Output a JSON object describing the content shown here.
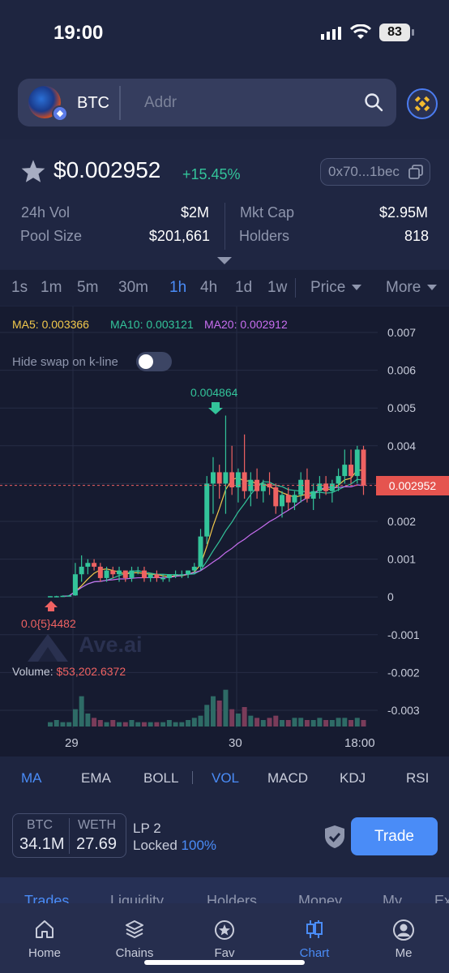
{
  "status": {
    "time": "19:00",
    "battery": "83"
  },
  "search": {
    "token_symbol": "BTC",
    "placeholder": "Addr"
  },
  "token": {
    "price": "$0.002952",
    "change": "+15.45%",
    "address_short": "0x70...1bec",
    "stats": {
      "vol_label": "24h Vol",
      "vol_value": "$2M",
      "mktcap_label": "Mkt Cap",
      "mktcap_value": "$2.95M",
      "pool_label": "Pool Size",
      "pool_value": "$201,661",
      "holders_label": "Holders",
      "holders_value": "818"
    }
  },
  "timeframes": [
    "1s",
    "1m",
    "5m",
    "30m",
    "1h",
    "4h",
    "1d",
    "1w"
  ],
  "active_timeframe": "1h",
  "dropdowns": {
    "price": "Price",
    "more": "More"
  },
  "chart_labels": {
    "ma5": "MA5: 0.003366",
    "ma10": "MA10: 0.003121",
    "ma20": "MA20: 0.002912",
    "hide_swap": "Hide swap on k-line",
    "high": "0.004864",
    "low": "0.0{5}4482",
    "watermark": "Ave.ai",
    "volume_label": "Volume: ",
    "volume_value": "$53,202.6372",
    "current_price": "0.002952"
  },
  "colors": {
    "up": "#33c49a",
    "down": "#ef6262",
    "accent": "#4a8cf7",
    "ma5": "#f2c94c",
    "ma10": "#33c49a",
    "ma20": "#c86ef0"
  },
  "chart_data": {
    "type": "candlestick",
    "y_ticks": [
      "0.007",
      "0.006",
      "0.005",
      "0.004",
      "0.003",
      "0.002",
      "0.001",
      "0",
      "-0.001",
      "-0.002",
      "-0.003"
    ],
    "ylim": [
      -0.0033,
      0.0074
    ],
    "x_ticks": [
      "29",
      "30",
      "18:00"
    ],
    "candles": [
      {
        "o": 1e-05,
        "h": 2e-05,
        "l": 0.0,
        "c": 2e-05
      },
      {
        "o": 2e-05,
        "h": 3e-05,
        "l": 1e-05,
        "c": 2e-05
      },
      {
        "o": 2e-05,
        "h": 4e-05,
        "l": 1e-05,
        "c": 3e-05
      },
      {
        "o": 3e-05,
        "h": 5e-05,
        "l": 2e-05,
        "c": 4e-05
      },
      {
        "o": 4e-05,
        "h": 0.0009,
        "l": 3e-05,
        "c": 0.0006
      },
      {
        "o": 0.0006,
        "h": 0.0011,
        "l": 0.0004,
        "c": 0.0008
      },
      {
        "o": 0.0008,
        "h": 0.001,
        "l": 0.0006,
        "c": 0.0009
      },
      {
        "o": 0.0009,
        "h": 0.001,
        "l": 0.0007,
        "c": 0.0008
      },
      {
        "o": 0.0008,
        "h": 0.0009,
        "l": 0.0004,
        "c": 0.0005
      },
      {
        "o": 0.0005,
        "h": 0.0008,
        "l": 0.0004,
        "c": 0.0007
      },
      {
        "o": 0.0007,
        "h": 0.0008,
        "l": 0.0005,
        "c": 0.0006
      },
      {
        "o": 0.0006,
        "h": 0.0008,
        "l": 0.0004,
        "c": 0.0007
      },
      {
        "o": 0.0007,
        "h": 0.0007,
        "l": 0.0004,
        "c": 0.0005
      },
      {
        "o": 0.0005,
        "h": 0.0008,
        "l": 0.0004,
        "c": 0.0007
      },
      {
        "o": 0.0007,
        "h": 0.0008,
        "l": 0.0006,
        "c": 0.0007
      },
      {
        "o": 0.0007,
        "h": 0.0008,
        "l": 0.0004,
        "c": 0.0005
      },
      {
        "o": 0.0005,
        "h": 0.0006,
        "l": 0.0004,
        "c": 0.0006
      },
      {
        "o": 0.0006,
        "h": 0.0007,
        "l": 0.0004,
        "c": 0.0005
      },
      {
        "o": 0.0005,
        "h": 0.0006,
        "l": 0.0004,
        "c": 0.0005
      },
      {
        "o": 0.0005,
        "h": 0.0006,
        "l": 0.0004,
        "c": 0.0006
      },
      {
        "o": 0.0006,
        "h": 0.0007,
        "l": 0.0005,
        "c": 0.0006
      },
      {
        "o": 0.0006,
        "h": 0.0007,
        "l": 0.0005,
        "c": 0.0006
      },
      {
        "o": 0.0006,
        "h": 0.0007,
        "l": 0.0005,
        "c": 0.0007
      },
      {
        "o": 0.0007,
        "h": 0.0009,
        "l": 0.0006,
        "c": 0.0008
      },
      {
        "o": 0.0008,
        "h": 0.0018,
        "l": 0.0007,
        "c": 0.0016
      },
      {
        "o": 0.0016,
        "h": 0.0032,
        "l": 0.0014,
        "c": 0.003
      },
      {
        "o": 0.003,
        "h": 0.0037,
        "l": 0.0022,
        "c": 0.0033
      },
      {
        "o": 0.0033,
        "h": 0.0035,
        "l": 0.0026,
        "c": 0.003
      },
      {
        "o": 0.003,
        "h": 0.0048,
        "l": 0.0022,
        "c": 0.0033
      },
      {
        "o": 0.0033,
        "h": 0.004,
        "l": 0.0027,
        "c": 0.0029
      },
      {
        "o": 0.0029,
        "h": 0.0034,
        "l": 0.0025,
        "c": 0.0033
      },
      {
        "o": 0.0033,
        "h": 0.0043,
        "l": 0.0026,
        "c": 0.0028
      },
      {
        "o": 0.0028,
        "h": 0.0033,
        "l": 0.0024,
        "c": 0.0031
      },
      {
        "o": 0.0031,
        "h": 0.0034,
        "l": 0.0026,
        "c": 0.0028
      },
      {
        "o": 0.0028,
        "h": 0.0031,
        "l": 0.0025,
        "c": 0.003
      },
      {
        "o": 0.003,
        "h": 0.0033,
        "l": 0.0027,
        "c": 0.0029
      },
      {
        "o": 0.0029,
        "h": 0.003,
        "l": 0.0022,
        "c": 0.0024
      },
      {
        "o": 0.0024,
        "h": 0.0028,
        "l": 0.0021,
        "c": 0.0027
      },
      {
        "o": 0.0027,
        "h": 0.0029,
        "l": 0.0023,
        "c": 0.0025
      },
      {
        "o": 0.0025,
        "h": 0.0028,
        "l": 0.0023,
        "c": 0.0027
      },
      {
        "o": 0.0027,
        "h": 0.0033,
        "l": 0.0025,
        "c": 0.0031
      },
      {
        "o": 0.0031,
        "h": 0.0034,
        "l": 0.0025,
        "c": 0.0026
      },
      {
        "o": 0.0026,
        "h": 0.003,
        "l": 0.0023,
        "c": 0.0028
      },
      {
        "o": 0.0028,
        "h": 0.0032,
        "l": 0.0026,
        "c": 0.003
      },
      {
        "o": 0.003,
        "h": 0.0032,
        "l": 0.0027,
        "c": 0.0028
      },
      {
        "o": 0.0028,
        "h": 0.0031,
        "l": 0.0025,
        "c": 0.003
      },
      {
        "o": 0.003,
        "h": 0.0034,
        "l": 0.0028,
        "c": 0.0032
      },
      {
        "o": 0.0032,
        "h": 0.0039,
        "l": 0.003,
        "c": 0.0035
      },
      {
        "o": 0.0035,
        "h": 0.0039,
        "l": 0.003,
        "c": 0.0032
      },
      {
        "o": 0.0032,
        "h": 0.004,
        "l": 0.003,
        "c": 0.0039
      },
      {
        "o": 0.0039,
        "h": 0.004,
        "l": 0.0027,
        "c": 0.00295
      }
    ],
    "volumes": [
      2,
      3,
      2,
      2,
      8,
      14,
      6,
      4,
      3,
      2,
      3,
      2,
      2,
      3,
      2,
      2,
      2,
      2,
      2,
      3,
      2,
      2,
      3,
      4,
      5,
      10,
      14,
      12,
      17,
      8,
      6,
      9,
      5,
      4,
      3,
      4,
      5,
      3,
      3,
      4,
      4,
      3,
      3,
      4,
      3,
      3,
      4,
      4,
      3,
      4,
      3
    ],
    "volume_max": 60
  },
  "indicators": [
    "MA",
    "EMA",
    "BOLL",
    "VOL",
    "MACD",
    "KDJ",
    "RSI"
  ],
  "active_indicators": [
    "MA",
    "VOL"
  ],
  "pool": {
    "sym1": "BTC",
    "val1": "34.1M",
    "sym2": "WETH",
    "val2": "27.69",
    "lp_label": "LP 2",
    "locked_label": "Locked ",
    "locked_pct": "100%"
  },
  "trade_label": "Trade",
  "subtabs": [
    "Trades",
    "Liquidity",
    "Holders",
    "Money",
    "My",
    "Ex"
  ],
  "nav": [
    {
      "label": "Home",
      "icon": "home-icon"
    },
    {
      "label": "Chains",
      "icon": "layers-icon"
    },
    {
      "label": "Fav",
      "icon": "star-badge-icon"
    },
    {
      "label": "Chart",
      "icon": "candles-icon"
    },
    {
      "label": "Me",
      "icon": "person-icon"
    }
  ],
  "active_nav": "Chart"
}
